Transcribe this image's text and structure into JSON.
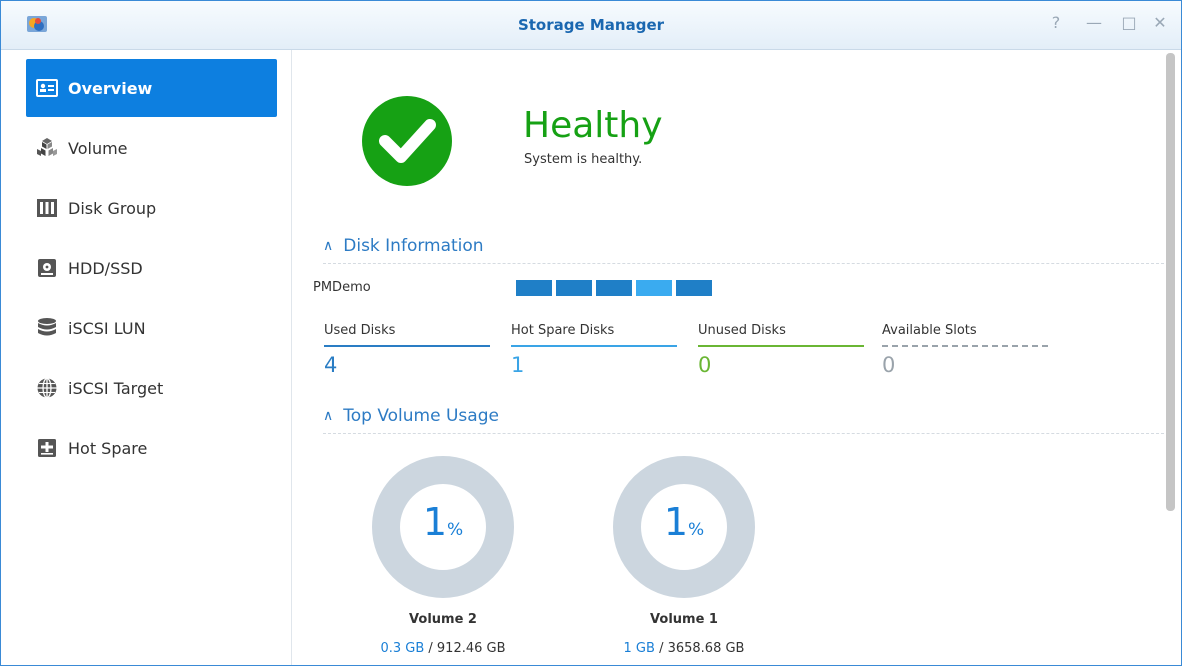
{
  "window": {
    "title": "Storage Manager",
    "controls": {
      "help": "?",
      "minimize": "—",
      "maximize": "□",
      "close": "✕"
    }
  },
  "sidebar": {
    "items": [
      {
        "label": "Overview",
        "icon": "overview-icon",
        "active": true
      },
      {
        "label": "Volume",
        "icon": "volume-icon"
      },
      {
        "label": "Disk Group",
        "icon": "disk-group-icon"
      },
      {
        "label": "HDD/SSD",
        "icon": "hdd-icon"
      },
      {
        "label": "iSCSI LUN",
        "icon": "iscsi-lun-icon"
      },
      {
        "label": "iSCSI Target",
        "icon": "iscsi-target-icon"
      },
      {
        "label": "Hot Spare",
        "icon": "hot-spare-icon"
      }
    ]
  },
  "status": {
    "title": "Healthy",
    "message": "System is healthy.",
    "color": "#16a114"
  },
  "disk_info": {
    "header": "Disk Information",
    "device": "PMDemo",
    "slots": [
      "used",
      "used",
      "used",
      "hot-spare",
      "used"
    ],
    "stats": [
      {
        "label": "Used Disks",
        "value": "4",
        "color": "#2a7dc4"
      },
      {
        "label": "Hot Spare Disks",
        "value": "1",
        "color": "#3aa4e6"
      },
      {
        "label": "Unused Disks",
        "value": "0",
        "color": "#6ab634"
      },
      {
        "label": "Available Slots",
        "value": "0",
        "color": "#9aa3ab"
      }
    ]
  },
  "volume_usage": {
    "header": "Top Volume Usage",
    "volumes": [
      {
        "name": "Volume 2",
        "percent": "1",
        "unit": "%",
        "used": "0.3 GB",
        "total": " / 912.46 GB"
      },
      {
        "name": "Volume 1",
        "percent": "1",
        "unit": "%",
        "used": "1 GB",
        "total": " / 3658.68 GB"
      }
    ]
  }
}
